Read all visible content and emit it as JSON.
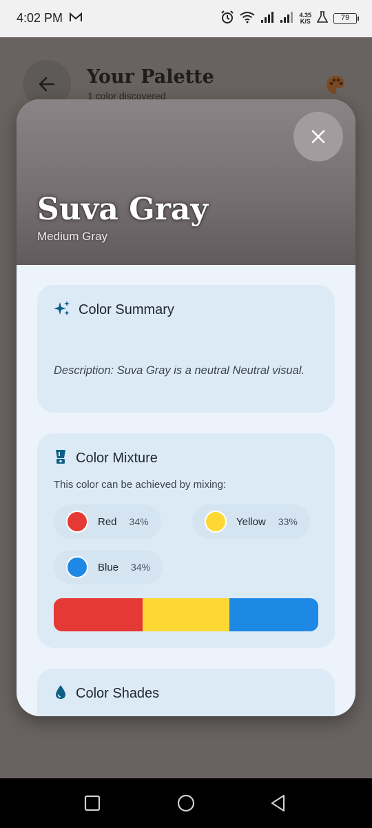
{
  "status_bar": {
    "time": "4:02 PM",
    "speed_value": "4.35",
    "speed_unit": "K/S",
    "battery": "79"
  },
  "background": {
    "title": "Your Palette",
    "subtitle": "1 color discovered"
  },
  "modal": {
    "color_name": "Suva Gray",
    "color_subtitle": "Medium Gray",
    "hero_color": "#7b7476",
    "summary": {
      "title": "Color Summary",
      "description": "Description: Suva Gray is a neutral Neutral visual."
    },
    "mixture": {
      "title": "Color Mixture",
      "intro": "This color can be achieved by mixing:",
      "components": [
        {
          "name": "Red",
          "percent": "34%",
          "color": "#e53935",
          "fraction": 0.34
        },
        {
          "name": "Yellow",
          "percent": "33%",
          "color": "#fdd835",
          "fraction": 0.33
        },
        {
          "name": "Blue",
          "percent": "34%",
          "color": "#1e88e5",
          "fraction": 0.34
        }
      ]
    },
    "shades": {
      "title": "Color Shades"
    }
  }
}
